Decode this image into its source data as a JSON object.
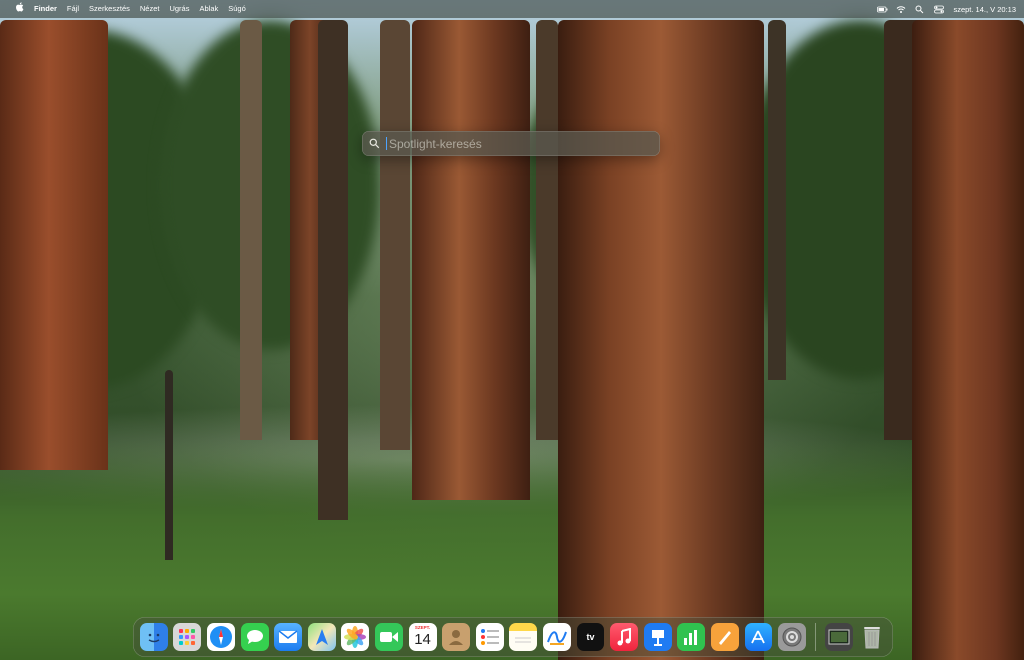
{
  "menubar": {
    "app_name": "Finder",
    "menus": [
      "Fájl",
      "Szerkesztés",
      "Nézet",
      "Ugrás",
      "Ablak",
      "Súgó"
    ],
    "status_icons": [
      "battery-icon",
      "wifi-icon",
      "search-icon",
      "control-center-icon"
    ],
    "clock": "szept. 14., V 20:13"
  },
  "spotlight": {
    "placeholder": "Spotlight-keresés",
    "value": ""
  },
  "dock": {
    "calendar_month": "SZEPT.",
    "calendar_day": "14",
    "tv_label": "tv",
    "apps": [
      "Finder",
      "Launchpad",
      "Safari",
      "Messages",
      "Mail",
      "Maps",
      "Photos",
      "FaceTime",
      "Calendar",
      "Contacts",
      "Reminders",
      "Notes",
      "Freeform",
      "TV",
      "Music",
      "Keynote",
      "Numbers",
      "Pages",
      "App Store",
      "System Settings",
      "Preview",
      "Trash"
    ]
  }
}
